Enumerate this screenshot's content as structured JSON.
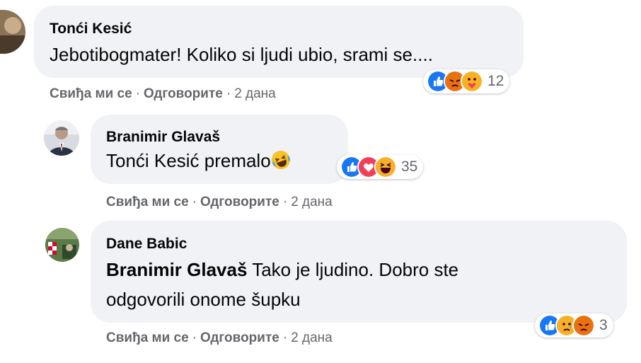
{
  "comments": [
    {
      "author": "Tonći Kesić",
      "text": "Jebotibogmater! Koliko si ljudi ubio, srami se....",
      "actions": {
        "like": "Свиђа ми се",
        "reply": "Одговорите",
        "time": "2 дана"
      },
      "reactions": {
        "icons": [
          "like-icon",
          "angry-icon",
          "care-icon"
        ],
        "count": "12"
      }
    },
    {
      "author": "Branimir Glavaš",
      "mention": "Tonći Kesić",
      "text": "premalo",
      "inline_emoji": "laughing-emoji-icon",
      "actions": {
        "like": "Свиђа ми се",
        "reply": "Одговорите",
        "time": "2 дана"
      },
      "reactions": {
        "icons": [
          "like-icon",
          "love-icon",
          "haha-icon"
        ],
        "count": "35"
      }
    },
    {
      "author": "Dane Babic",
      "mention": "Branimir Glavaš",
      "text_line1": "Tako je ljudino. Dobro ste",
      "text_line2": "odgovorili onome šupku",
      "actions": {
        "like": "Свиђа ми се",
        "reply": "Одговорите",
        "time": "2 дана"
      },
      "reactions": {
        "icons": [
          "like-icon",
          "sad-icon",
          "angry-icon"
        ],
        "count": "3"
      }
    }
  ],
  "colors": {
    "bubble": "#f0f2f5",
    "like_blue": "#1877f2",
    "love_red": "#f33e58",
    "angry": "#e9710f",
    "haha_yellow": "#f7b125",
    "meta_gray": "#65676b"
  },
  "separator": "·"
}
